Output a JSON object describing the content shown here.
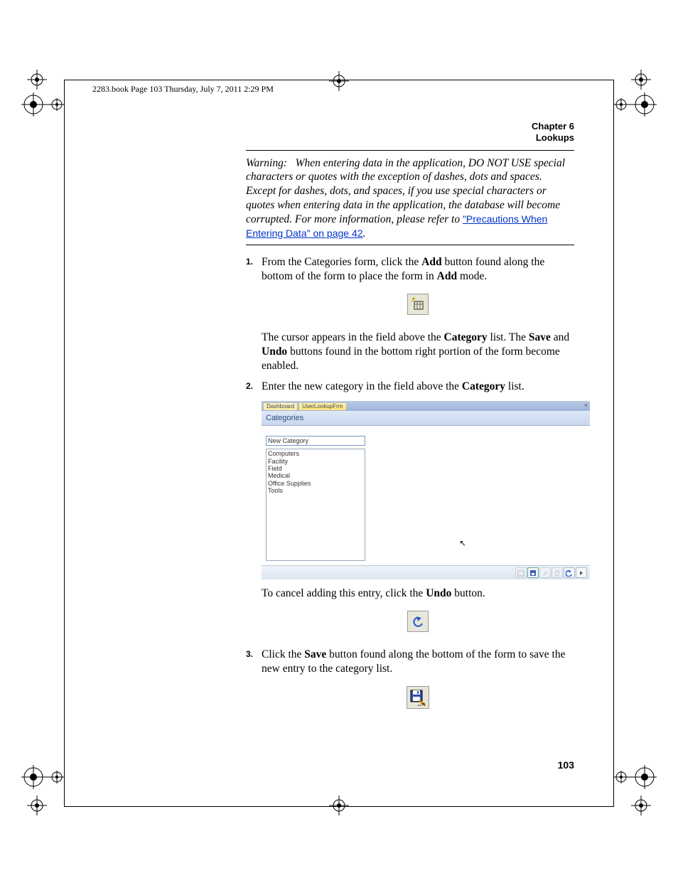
{
  "running_head": "2283.book  Page 103  Thursday, July 7, 2011  2:29 PM",
  "header": {
    "chapter": "Chapter 6",
    "title": "Lookups"
  },
  "warning": {
    "label": "Warning:",
    "body": "When entering data in the application, DO NOT USE special characters or quotes with the exception of dashes, dots and spaces. Except for dashes, dots, and spaces, if you use special characters or quotes when entering data in the application, the database will become corrupted. For more information, please refer to",
    "link_text": "\"Precautions When Entering Data\" on page 42",
    "after_link": "."
  },
  "steps": {
    "s1": {
      "num": "1.",
      "p1a": "From the Categories form, click the ",
      "p1b": "Add",
      "p1c": " button found along the bottom of the form to place the form in ",
      "p1d": "Add",
      "p1e": " mode.",
      "p2a": "The cursor appears in the field above the ",
      "p2b": "Category",
      "p2c": " list. The ",
      "p2d": "Save",
      "p2e": " and ",
      "p2f": "Undo",
      "p2g": " buttons found in the bottom right portion of the form become enabled."
    },
    "s2": {
      "num": "2.",
      "p1a": "Enter the new category in the field above the ",
      "p1b": "Category",
      "p1c": " list.",
      "p2a": "To cancel adding this entry, click the ",
      "p2b": "Undo",
      "p2c": " button."
    },
    "s3": {
      "num": "3.",
      "p1a": "Click the ",
      "p1b": "Save",
      "p1c": " button found along the bottom of the form to save the new entry to the category list."
    }
  },
  "figure": {
    "tabs": {
      "t1": "Dashboard",
      "t2": "UserLookupFrm"
    },
    "title": "Categories",
    "input_value": "New Category",
    "items": [
      "Computers",
      "Facility",
      "Field",
      "Medical",
      "Office Supplies",
      "Tools"
    ]
  },
  "page_number": "103"
}
